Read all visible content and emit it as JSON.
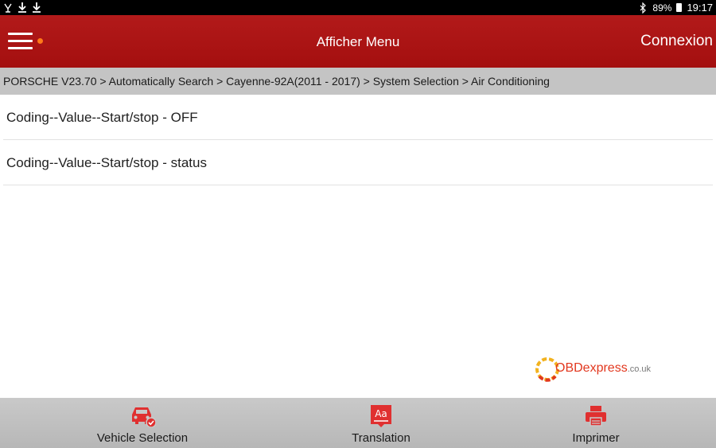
{
  "status_bar": {
    "battery": "89%",
    "time": "19:17"
  },
  "header": {
    "title": "Afficher Menu",
    "connexion_label": "Connexion"
  },
  "breadcrumb": "PORSCHE V23.70 > Automatically Search > Cayenne-92A(2011 - 2017) > System Selection > Air Conditioning",
  "items": [
    {
      "label": "Coding--Value--Start/stop - OFF"
    },
    {
      "label": "Coding--Value--Start/stop - status"
    }
  ],
  "watermark": {
    "brand": "OBDexpress",
    "tld": ".co.uk"
  },
  "bottom_bar": {
    "vehicle_selection": "Vehicle Selection",
    "translation": "Translation",
    "print": "Imprimer"
  },
  "colors": {
    "header_red": "#ae1414",
    "accent_red": "#e03030",
    "menu_dot": "#ff7a1a"
  }
}
